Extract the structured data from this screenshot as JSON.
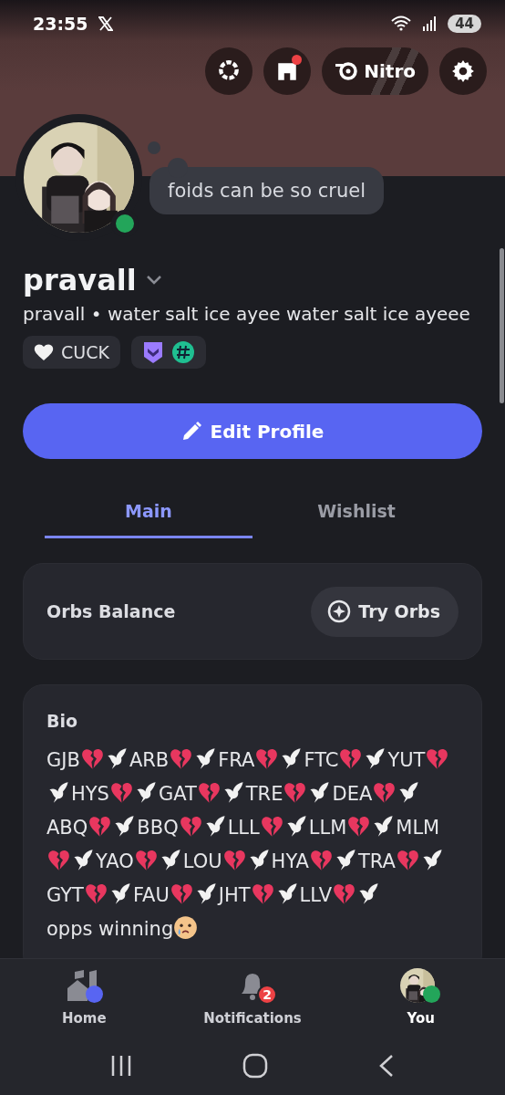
{
  "status_bar": {
    "time": "23:55",
    "battery": "44"
  },
  "header_buttons": [
    {
      "kind": "quests"
    },
    {
      "kind": "shop",
      "badge": true
    },
    {
      "kind": "nitro",
      "label": "Nitro"
    },
    {
      "kind": "settings"
    }
  ],
  "profile": {
    "kind": "picture",
    "online": true,
    "status_bubble": "foids can be so cruel",
    "display_name": "pravall",
    "subtitle": "pravall • water salt ice ayee water salt ice ayeee",
    "tags": [
      {
        "kind": "clan",
        "label": "CUCK"
      },
      {
        "kind": "badges"
      }
    ]
  },
  "edit_button": "Edit Profile",
  "tabs": [
    {
      "label": "Main",
      "selected": true
    },
    {
      "label": "Wishlist",
      "selected": false
    }
  ],
  "orbs_card": {
    "title": "Orbs Balance",
    "button": "Try Orbs"
  },
  "bio": {
    "title": "Bio",
    "entries": [
      {
        "text": "GJB",
        "kind": "heart-dove"
      },
      {
        "text": "ARB",
        "kind": "heart-dove"
      },
      {
        "text": "FRA",
        "kind": "heart-dove"
      },
      {
        "text": "FTC",
        "kind": "heart-dove"
      },
      {
        "text": "YUT",
        "kind": "heart-dove"
      },
      {
        "text": "HYS",
        "kind": "heart-dove"
      },
      {
        "text": "GAT",
        "kind": "heart-dove"
      },
      {
        "text": "TRE",
        "kind": "heart-dove"
      },
      {
        "text": "DEA",
        "kind": "heart-dove"
      },
      {
        "text": "ABQ",
        "kind": "heart-dove"
      },
      {
        "text": "BBQ",
        "kind": "heart-dove"
      },
      {
        "text": "LLL",
        "kind": "heart-dove"
      },
      {
        "text": "LLM",
        "kind": "heart-dove"
      },
      {
        "text": "MLM",
        "kind": "heart-dove"
      },
      {
        "text": "YAO",
        "kind": "heart-dove"
      },
      {
        "text": "LOU",
        "kind": "heart-dove"
      },
      {
        "text": "HYA",
        "kind": "heart-dove"
      },
      {
        "text": "TRA",
        "kind": "heart-dove"
      },
      {
        "text": "GYT",
        "kind": "heart-dove"
      },
      {
        "text": "FAU",
        "kind": "heart-dove"
      },
      {
        "text": "JHT",
        "kind": "heart-dove"
      },
      {
        "text": "LLV",
        "kind": "heart-dove"
      },
      {
        "text": "opps winning",
        "kind": "crying"
      }
    ]
  },
  "bottom_nav": [
    {
      "kind": "home",
      "label": "Home",
      "selected": false,
      "dot": true
    },
    {
      "kind": "notifications",
      "label": "Notifications",
      "selected": false,
      "count": "2"
    },
    {
      "kind": "you",
      "label": "You",
      "selected": true,
      "online": true
    }
  ]
}
